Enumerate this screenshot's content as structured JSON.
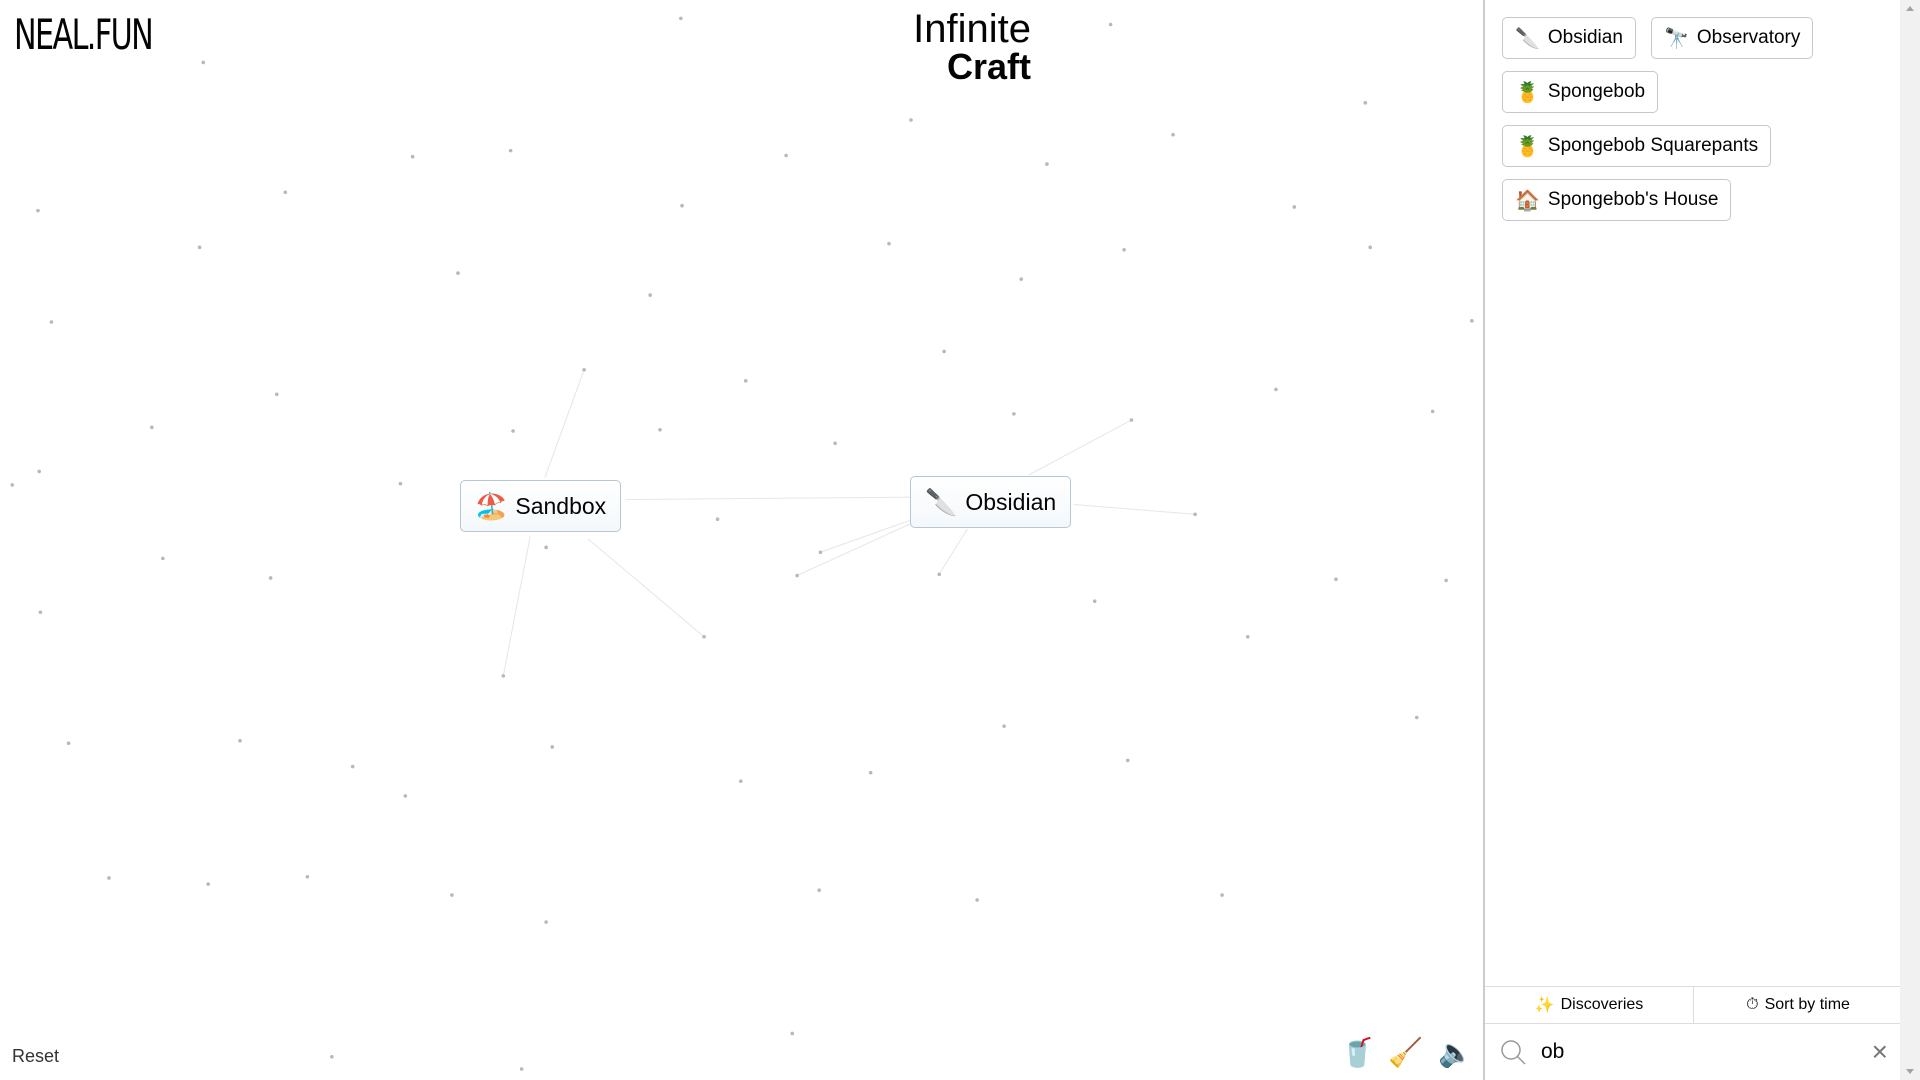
{
  "header": {
    "logo": "NEAL.FUN",
    "title_line1": "Infinite",
    "title_line2": "Craft"
  },
  "canvas": {
    "items": [
      {
        "emoji": "🏖️",
        "label": "Sandbox"
      },
      {
        "emoji": "🔪",
        "label": "Obsidian"
      }
    ]
  },
  "footer": {
    "reset": "Reset",
    "icons": [
      "coffee-cup-icon",
      "broom-icon",
      "speaker-icon"
    ]
  },
  "sidebar": {
    "items": [
      {
        "emoji": "🔪",
        "label": "Obsidian"
      },
      {
        "emoji": "🔭",
        "label": "Observatory"
      },
      {
        "emoji": "🍍",
        "label": "Spongebob"
      },
      {
        "emoji": "🍍",
        "label": "Spongebob Squarepants"
      },
      {
        "emoji": "🏠",
        "label": "Spongebob's House"
      }
    ],
    "tabs": [
      {
        "icon": "✨",
        "label": "Discoveries"
      },
      {
        "icon": "⏱",
        "label": "Sort by time"
      }
    ],
    "search": {
      "value": "ob",
      "placeholder": "Search"
    }
  }
}
